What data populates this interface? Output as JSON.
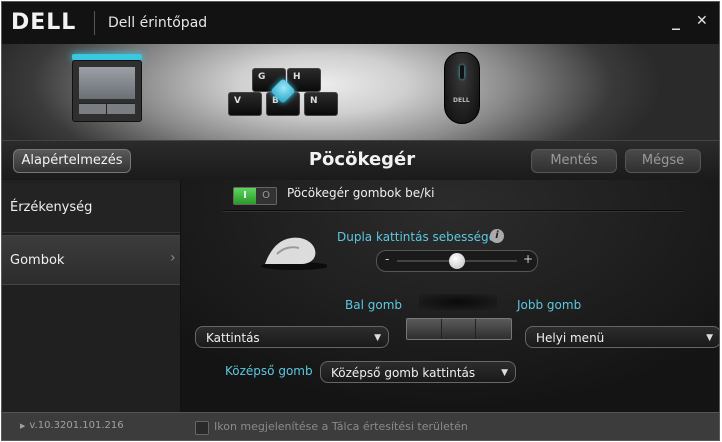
{
  "window": {
    "brand": "DELL",
    "title": "Dell érintőpad",
    "minimize": "_",
    "close": "✕"
  },
  "banner": {
    "keys": [
      "G",
      "H",
      "V",
      "B",
      "N"
    ],
    "mouse_label": "DELL"
  },
  "header": {
    "default_label": "Alapértelmezés",
    "page_title": "Pöcökegér",
    "save_label": "Mentés",
    "cancel_label": "Mégse"
  },
  "sidebar": {
    "items": [
      {
        "label": "Érzékenység"
      },
      {
        "label": "Gombok"
      }
    ],
    "chevron": "›"
  },
  "main": {
    "toggle": {
      "on": "I",
      "off": "O",
      "label": "Pöcökegér gombok be/ki",
      "state": true
    },
    "double_click": {
      "label": "Dupla kattintás sebessége",
      "info": "i",
      "minus": "-",
      "plus": "+",
      "value": 0.5
    },
    "left_button": {
      "label": "Bal gomb",
      "value": "Kattintás"
    },
    "right_button": {
      "label": "Jobb gomb",
      "value": "Helyi menü"
    },
    "middle_button": {
      "label": "Középső gomb",
      "value": "Középső gomb kattintás"
    },
    "dropdown_arrow": "▼"
  },
  "footer": {
    "version": "v.10.3201.101.216",
    "version_arrow": "▶",
    "tray_checkbox_label": "Ikon megjelenítése a Tálca értesítési területén",
    "tray_checked": false
  },
  "colors": {
    "accent": "#5cc8e0",
    "toggle_on": "#3cb83c"
  }
}
